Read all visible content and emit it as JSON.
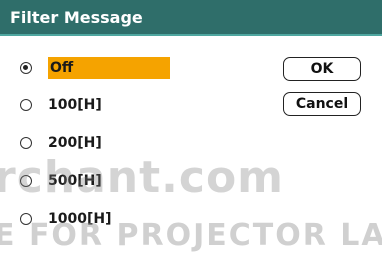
{
  "dialog": {
    "title": "Filter Message",
    "options": [
      {
        "label": "Off",
        "selected": true
      },
      {
        "label": "100[H]",
        "selected": false
      },
      {
        "label": "200[H]",
        "selected": false
      },
      {
        "label": "500[H]",
        "selected": false
      },
      {
        "label": "1000[H]",
        "selected": false
      }
    ],
    "ok_label": "OK",
    "cancel_label": "Cancel"
  },
  "watermark": {
    "line1": "rchant.com",
    "line2": "E FOR PROJECTOR LAM"
  },
  "colors": {
    "title_bar": "#2f6e6a",
    "highlight": "#f5a300"
  }
}
